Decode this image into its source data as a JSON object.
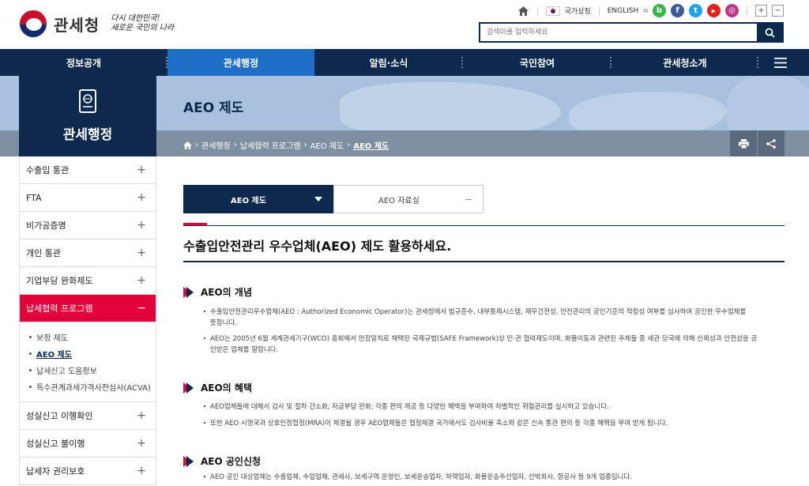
{
  "header": {
    "logo_text": "관세청",
    "slogan_line1": "다시 대한민국!",
    "slogan_line2": "새로운 국민의 나라",
    "util": {
      "national_symbol": "국가상징",
      "english": "ENGLISH"
    },
    "sns": [
      "b",
      "f",
      "t",
      "▶",
      "◎"
    ],
    "zoom_in": "+",
    "zoom_out": "−",
    "search_placeholder": "검색어를 입력하세요"
  },
  "gnb": {
    "items": [
      "정보공개",
      "관세행정",
      "알림·소식",
      "국민참여",
      "관세청소개"
    ],
    "active_index": 1
  },
  "lnb": {
    "title": "관세행정",
    "items": [
      "수출입 통관",
      "FTA",
      "비가공증명",
      "개인 통관",
      "기업부담 완화제도",
      "납세협력 프로그램",
      "성실신고 이행확인",
      "성실신고 불이행",
      "납세자 권리보호"
    ],
    "active_index": 5,
    "sub_items": [
      "보정 제도",
      "AEO 제도",
      "납세신고 도움정보",
      "특수관계과세가격사전심사(ACVA)"
    ],
    "sub_active_index": 1
  },
  "page": {
    "title": "AEO 제도",
    "breadcrumb": [
      "관세행정",
      "납세협력 프로그램",
      "AEO 제도",
      "AEO 제도"
    ]
  },
  "tabs": [
    "AEO 제도",
    "AEO 자료실"
  ],
  "content": {
    "heading": "수출입안전관리 우수업체(AEO) 제도 활용하세요.",
    "sections": [
      {
        "title": "AEO의 개념",
        "paras": [
          [
            "수출입안전관리우수업체(AEO : Authorized Economic Operator)는 관세청에서 법규준수, 내부통제시스템, 재무건전성, 안전관리의 공인기준의 적정성 여부를 심사하여 공인한 우수업체를",
            "뜻합니다."
          ],
          [
            "AEO는 2005년 6월 세계관세기구(WCO) 총회에서 만장일치로 채택된 국제규범(SAFE Framework)상 민·관 협력제도이며, 화물이동과 관련된 주체들 중 세관 당국에 의해 신뢰성과 안전성을 공",
            "인받은 업체를 말합니다."
          ]
        ]
      },
      {
        "title": "AEO의 혜택",
        "paras": [
          [
            "AEO업체들에 대해서 검사 및 절차 간소화, 자금부담 완화, 각종 편의 제공 등 다양한 혜택을 부여하여 차별적인 위험관리를 실시하고 있습니다."
          ],
          [
            "또한 AEO 시행국과 상호인정협정(MRA)이 체결될 경우 AEO업체들은 협정체결 국가에서도 검사비율 축소와 같은 신속 통관 편의 등 각종 혜택을 부여 받게 됩니다."
          ]
        ]
      },
      {
        "title": "AEO 공인신청",
        "paras": [
          [
            "AEO 공인 대상업체는 수출업체, 수입업체, 관세사, 보세구역 운영인, 보세운송업자, 하역업자, 화물운송주선업자, 선박회사, 항공사 등 9개 업종입니다."
          ]
        ]
      }
    ]
  },
  "colors": {
    "navy": "#0d2a4e",
    "active_blue": "#1f6fc6",
    "accent_red": "#e4003a"
  }
}
